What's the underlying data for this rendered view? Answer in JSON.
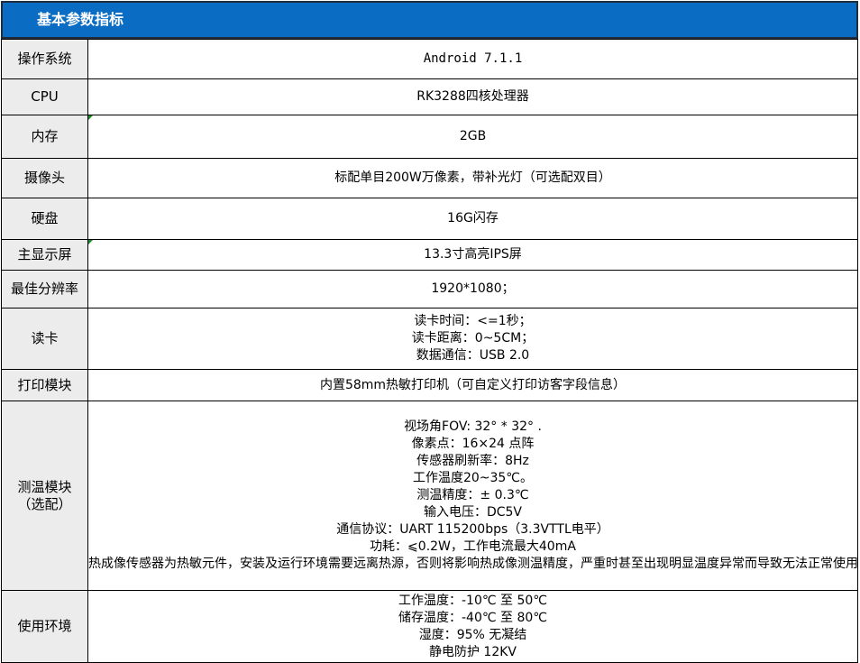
{
  "header": {
    "title": "基本参数指标"
  },
  "rows": [
    {
      "label": "操作系统",
      "lines": [
        "Android 7.1.1"
      ]
    },
    {
      "label": "CPU",
      "lines": [
        "RK3288四核处理器"
      ]
    },
    {
      "label": "内存",
      "lines": [
        "2GB"
      ]
    },
    {
      "label": "摄像头",
      "lines": [
        "标配单目200W万像素，带补光灯（可选配双目）"
      ]
    },
    {
      "label": "硬盘",
      "lines": [
        "16G闪存"
      ]
    },
    {
      "label": "主显示屏",
      "lines": [
        "13.3寸高亮IPS屏"
      ]
    },
    {
      "label": "最佳分辨率",
      "lines": [
        "1920*1080；"
      ]
    },
    {
      "label": "读卡",
      "lines": [
        "读卡时间：<=1秒；",
        "读卡距离：0~5CM；",
        "数据通信：USB 2.0"
      ]
    },
    {
      "label": "打印模块",
      "lines": [
        "内置58mm热敏打印机（可自定义打印访客字段信息）"
      ]
    },
    {
      "label": "测温模块",
      "label2": "（选配）",
      "lines": [
        "视场角FOV: 32° * 32° .",
        "像素点：16×24 点阵",
        "传感器刷新率：8Hz",
        "工作温度20~35℃。",
        "测温精度：± 0.3℃",
        "输入电压：DC5V",
        "通信协议：UART 115200bps（3.3VTTL电平）",
        "功耗：⩽0.2W，工作电流最大40mA",
        "热成像传感器为热敏元件，安装及运行环境需要远离热源，否则将影响热成像测温精度，严重时甚至出现明显温度异常而导致无法正常使用。"
      ]
    },
    {
      "label": "使用环境",
      "lines": [
        "工作温度：-10℃ 至 50℃",
        "储存温度：-40℃ 至 80℃",
        "湿度：95% 无凝结",
        "静电防护  12KV"
      ]
    }
  ]
}
